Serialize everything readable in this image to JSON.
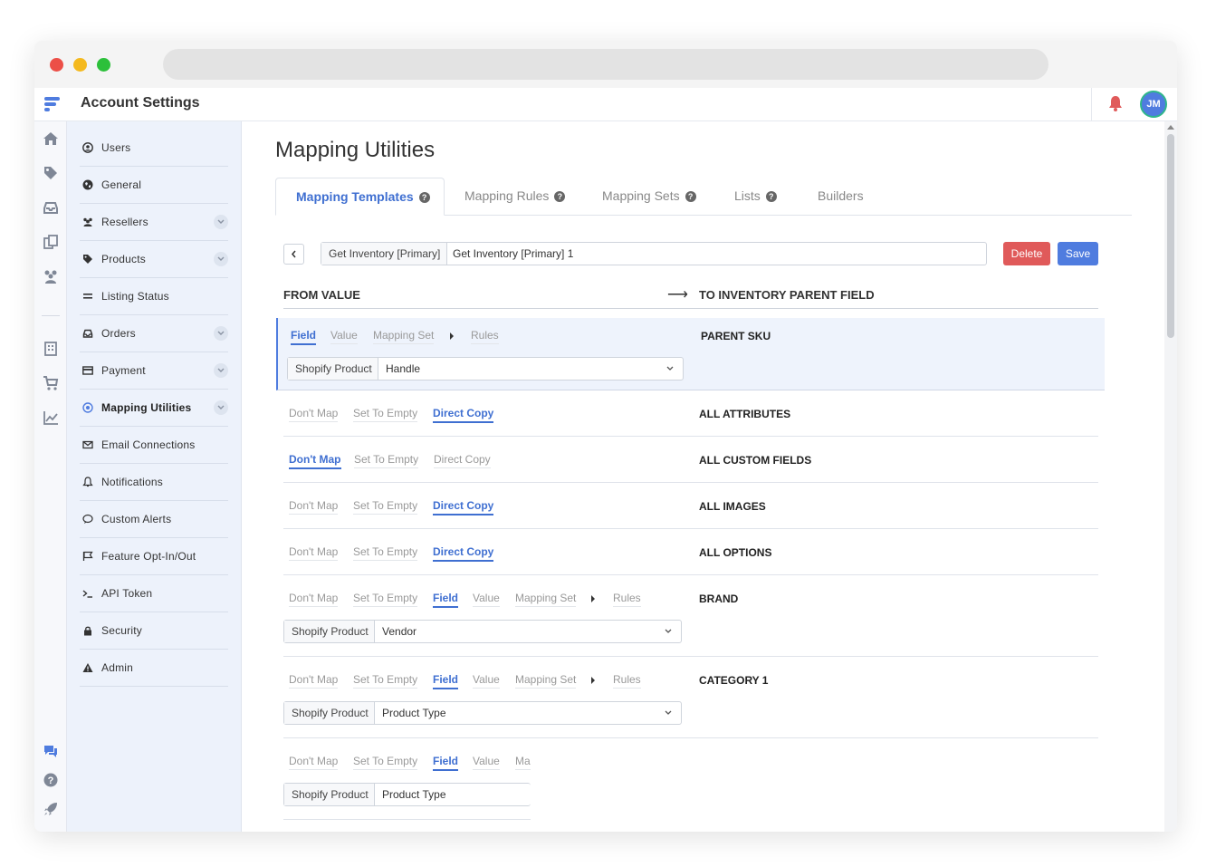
{
  "app": {
    "title": "Account Settings",
    "avatar_initials": "JM"
  },
  "colors": {
    "accent": "#4f7cdf",
    "delete": "#e05a5a",
    "sidebar_bg": "#edf2fb",
    "bell": "#e05a5a"
  },
  "sidebar": {
    "items": [
      {
        "label": "Users",
        "icon": "user-circle-icon"
      },
      {
        "label": "General",
        "icon": "globe-icon"
      },
      {
        "label": "Resellers",
        "icon": "users-icon"
      },
      {
        "label": "Products",
        "icon": "tag-icon"
      },
      {
        "label": "Listing Status",
        "icon": "list-icon"
      },
      {
        "label": "Orders",
        "icon": "inbox-icon"
      },
      {
        "label": "Payment",
        "icon": "credit-card-icon"
      },
      {
        "label": "Mapping Utilities",
        "icon": "target-icon"
      },
      {
        "label": "Email Connections",
        "icon": "envelope-icon"
      },
      {
        "label": "Notifications",
        "icon": "bell-icon"
      },
      {
        "label": "Custom Alerts",
        "icon": "comment-icon"
      },
      {
        "label": "Feature Opt-In/Out",
        "icon": "flag-icon"
      },
      {
        "label": "API Token",
        "icon": "terminal-icon"
      },
      {
        "label": "Security",
        "icon": "lock-icon"
      },
      {
        "label": "Admin",
        "icon": "warning-icon"
      }
    ]
  },
  "main": {
    "title": "Mapping Utilities",
    "tabs": [
      {
        "label": "Mapping Templates"
      },
      {
        "label": "Mapping Rules"
      },
      {
        "label": "Mapping Sets"
      },
      {
        "label": "Lists"
      },
      {
        "label": "Builders"
      }
    ],
    "template": {
      "prefix": "Get Inventory [Primary]",
      "name": "Get Inventory [Primary] 1"
    },
    "buttons": {
      "delete": "Delete",
      "save": "Save"
    },
    "columns": {
      "from": "FROM VALUE",
      "to": "TO INVENTORY PARENT FIELD"
    },
    "options": {
      "dont_map": "Don't Map",
      "set_to_empty": "Set To Empty",
      "direct_copy": "Direct Copy",
      "field": "Field",
      "value": "Value",
      "mapping_set": "Mapping Set",
      "mapping_set_cut": "Ma",
      "rules": "Rules"
    },
    "rows": [
      {
        "target": "PARENT SKU",
        "selected": "Field",
        "source_prefix": "Shopify Product",
        "source_value": "Handle"
      },
      {
        "target": "ALL ATTRIBUTES",
        "selected": "Direct Copy"
      },
      {
        "target": "ALL CUSTOM FIELDS",
        "selected": "Don't Map"
      },
      {
        "target": "ALL IMAGES",
        "selected": "Direct Copy"
      },
      {
        "target": "ALL OPTIONS",
        "selected": "Direct Copy"
      },
      {
        "target": "BRAND",
        "selected": "Field",
        "source_prefix": "Shopify Product",
        "source_value": "Vendor"
      },
      {
        "target": "CATEGORY 1",
        "selected": "Field",
        "source_prefix": "Shopify Product",
        "source_value": "Product Type"
      },
      {
        "target": "",
        "selected": "Field",
        "source_prefix": "Shopify Product",
        "source_value": "Product Type"
      }
    ]
  }
}
